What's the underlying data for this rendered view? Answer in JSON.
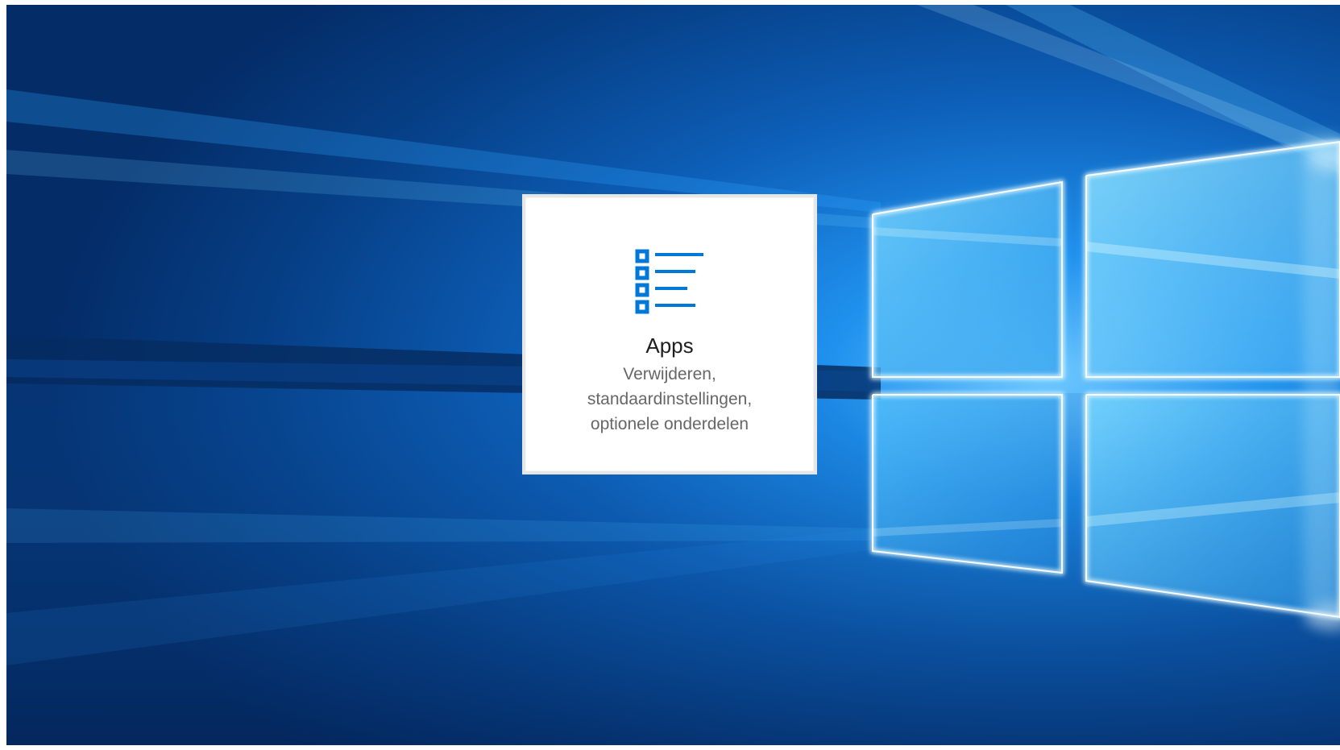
{
  "desktop": {
    "wallpaper_icon": "windows-logo-light-wallpaper"
  },
  "tile": {
    "icon": "apps-list-icon",
    "title": "Apps",
    "description_lines": [
      "Verwijderen,",
      "standaardinstellingen,",
      "optionele onderdelen"
    ],
    "accent_color": "#0078d7",
    "title_color": "#1f1f1f",
    "description_color": "#676767"
  }
}
